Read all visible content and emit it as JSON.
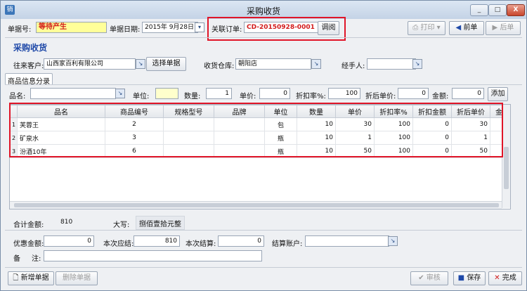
{
  "window": {
    "title": "采购收货",
    "app_icon": "销",
    "controls": [
      "_",
      "□",
      "X"
    ]
  },
  "header": {
    "doc_no_label": "单据号:",
    "doc_no_value": "等待产生",
    "doc_date_label": "单据日期:",
    "doc_date_value": "2015年 9月28日",
    "order_label": "关联订单:",
    "order_value": "CD-20150928-0001",
    "view_button": "调阅",
    "print_button": "打印",
    "prev_button": "前单",
    "next_button": "后单"
  },
  "section_title": "采购收货",
  "info": {
    "customer_label": "往来客户:",
    "customer_value": "山西家百利有限公司",
    "select_doc_button": "选择单据",
    "warehouse_label": "收货仓库:",
    "warehouse_value": "朝阳店",
    "handler_label": "经手人:",
    "handler_value": ""
  },
  "tab_label": "商品信息分录",
  "entry": {
    "name_label": "品名:",
    "unit_label": "单位:",
    "qty_label": "数量:",
    "qty_value": "1",
    "price_label": "单价:",
    "price_value": "0",
    "discount_label": "折扣率%:",
    "discount_value": "100",
    "after_price_label": "折后单价:",
    "after_price_value": "0",
    "amount_label": "金额:",
    "amount_value": "0",
    "add_button": "添加"
  },
  "table": {
    "columns": [
      "品名",
      "商品编号",
      "规格型号",
      "品牌",
      "单位",
      "数量",
      "单价",
      "折扣率%",
      "折扣金额",
      "折后单价",
      "金"
    ],
    "rows": [
      {
        "idx": "1",
        "name": "芙蓉王",
        "code": "2",
        "spec": "",
        "brand": "",
        "unit": "包",
        "qty": "10",
        "price": "30",
        "discount": "100",
        "disc_amt": "0",
        "after_price": "30"
      },
      {
        "idx": "2",
        "name": "矿泉水",
        "code": "3",
        "spec": "",
        "brand": "",
        "unit": "瓶",
        "qty": "10",
        "price": "1",
        "discount": "100",
        "disc_amt": "0",
        "after_price": "1"
      },
      {
        "idx": "3",
        "name": "汾酒10年",
        "code": "6",
        "spec": "",
        "brand": "",
        "unit": "瓶",
        "qty": "10",
        "price": "50",
        "discount": "100",
        "disc_amt": "0",
        "after_price": "50"
      }
    ]
  },
  "totals": {
    "sum_label": "合计金额:",
    "sum_value": "810",
    "caps_label": "大写:",
    "caps_value": "捌佰壹拾元整"
  },
  "payment": {
    "discount_label": "优惠金额:",
    "discount_value": "0",
    "due_label": "本次应结:",
    "due_value": "810",
    "settle_label": "本次结算:",
    "settle_value": "0",
    "account_label": "结算账户:",
    "account_value": "",
    "remark_label_a": "备",
    "remark_label_b": "注:",
    "remark_value": ""
  },
  "footer": {
    "new_button": "新增单据",
    "delete_button": "删除单据",
    "audit_button": "审核",
    "save_button": "保存",
    "done_button": "完成"
  },
  "colors": {
    "doc_no_bg": "#ffff99",
    "doc_no_text": "#d21a1a",
    "order_text": "#d21a1a",
    "highlight_box": "#e01528",
    "title_blue": "#1f49a8"
  }
}
